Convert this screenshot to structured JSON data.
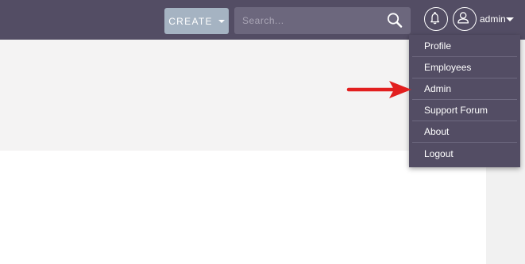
{
  "header": {
    "create_label": "CREATE",
    "search_placeholder": "Search...",
    "user_name": "admin"
  },
  "user_menu": {
    "items": [
      {
        "label": "Profile"
      },
      {
        "label": "Employees"
      },
      {
        "label": "Admin"
      },
      {
        "label": "Support Forum"
      },
      {
        "label": "About"
      },
      {
        "label": "Logout"
      }
    ]
  },
  "icons": {
    "search": "search-icon",
    "notifications": "bell-icon",
    "user": "user-avatar-icon",
    "annotation_arrow": "arrow-icon"
  },
  "colors": {
    "topbar": "#534d64",
    "create_button": "#a5b3c2",
    "search_box": "#6c677d",
    "annotation_arrow": "#e21f1f"
  }
}
